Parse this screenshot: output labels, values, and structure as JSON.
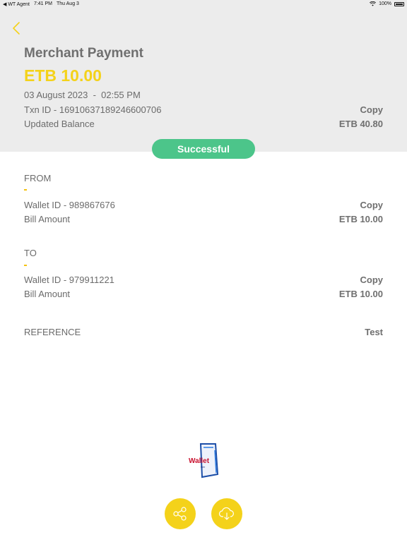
{
  "status_bar": {
    "carrier": "◀ WT Agent",
    "time": "7:41 PM",
    "date": "Thu Aug 3",
    "battery": "100%"
  },
  "header": {
    "title": "Merchant Payment",
    "amount": "ETB 10.00",
    "datetime": "03 August 2023  -  02:55 PM",
    "txn_id": "Txn ID - 1691063718924660070​6",
    "copy_label": "Copy",
    "balance_label": "Updated Balance",
    "balance_value": "ETB 40.80"
  },
  "status_badge": "Successful",
  "from": {
    "label": "FROM",
    "name": "-",
    "wallet_id": "Wallet ID - 989867676",
    "copy_label": "Copy",
    "bill_label": "Bill Amount",
    "bill_value": "ETB 10.00"
  },
  "to": {
    "label": "TO",
    "name": "-",
    "wallet_id": "Wallet ID - 979911221",
    "copy_label": "Copy",
    "bill_label": "Bill Amount",
    "bill_value": "ETB 10.00"
  },
  "reference": {
    "label": "REFERENCE",
    "value": "Test"
  },
  "logo": {
    "text": "Wallet",
    "sub": "Birr"
  },
  "colors": {
    "accent_yellow": "#f4d21a",
    "success_green": "#4cc58a",
    "header_bg": "#ececec"
  },
  "icons": [
    "back-chevron-icon",
    "share-icon",
    "cloud-download-icon",
    "wifi-icon",
    "battery-icon"
  ]
}
